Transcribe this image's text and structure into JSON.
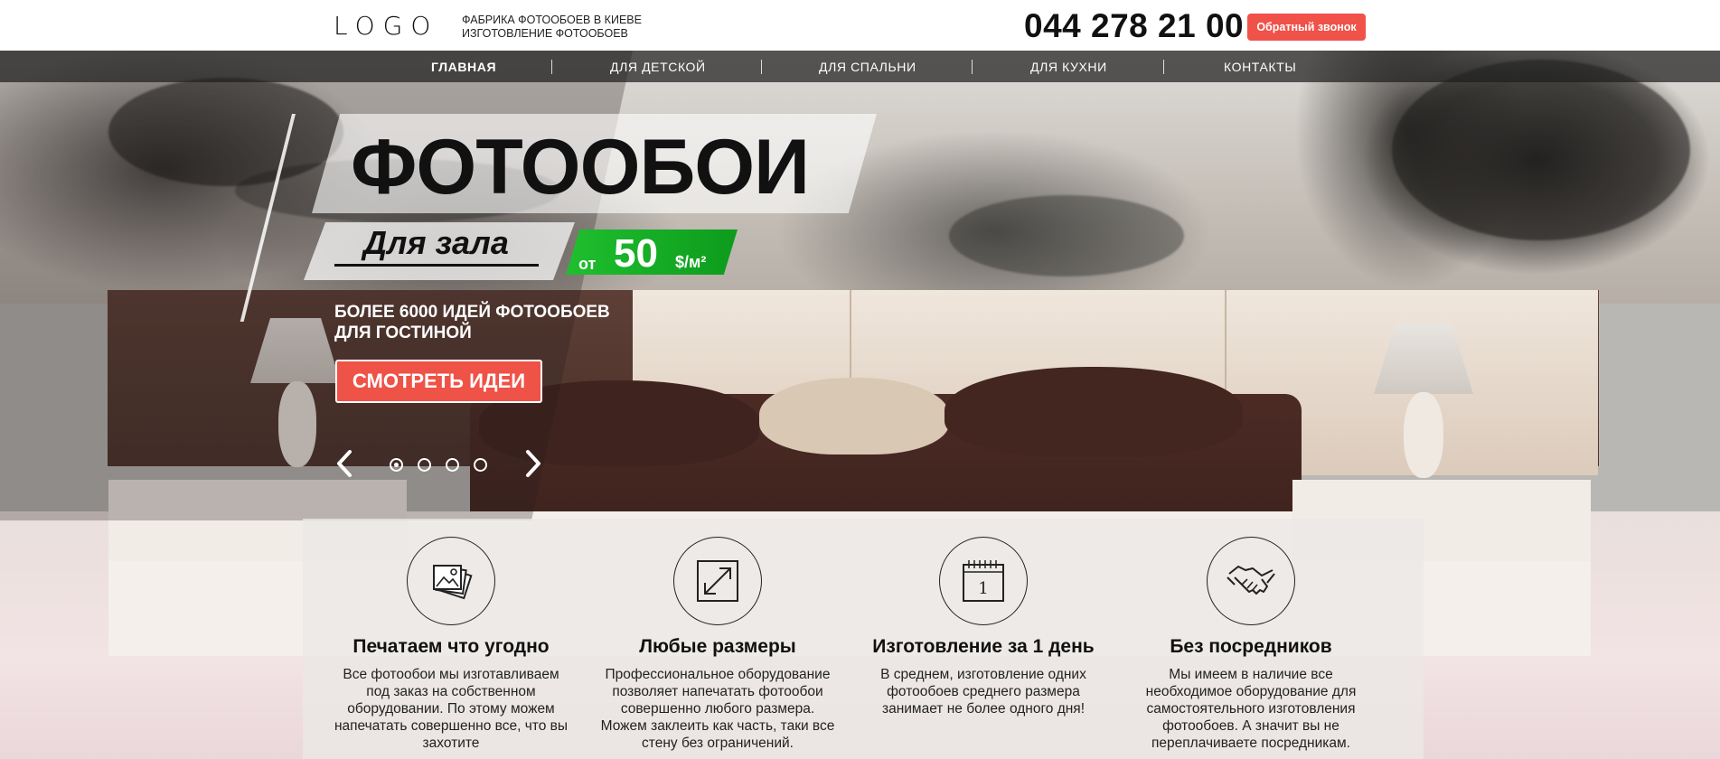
{
  "header": {
    "logo": "LOGO",
    "tagline_line1": "ФАБРИКА ФОТООБОЕВ В КИЕВЕ",
    "tagline_line2": "ИЗГОТОВЛЕНИЕ ФОТООБОЕВ",
    "phone": "044 278 21 00",
    "callback_label": "Обратный звонок"
  },
  "nav": {
    "items": [
      {
        "label": "ГЛАВНАЯ",
        "active": true
      },
      {
        "label": "ДЛЯ ДЕТСКОЙ"
      },
      {
        "label": "ДЛЯ СПАЛЬНИ"
      },
      {
        "label": "ДЛЯ КУХНИ"
      },
      {
        "label": "КОНТАКТЫ"
      }
    ]
  },
  "hero": {
    "title": "ФОТООБОИ",
    "subtitle": "Для зала",
    "price_from": "от",
    "price_value": "50",
    "price_unit": "$/м²",
    "lead_line1": "БОЛЕЕ 6000 ИДЕЙ ФОТООБОЕВ",
    "lead_line2": "ДЛЯ ГОСТИНОЙ",
    "cta_label": "СМОТРЕТЬ ИДЕИ",
    "slider_active_index": 0
  },
  "features": [
    {
      "icon": "photos-icon",
      "title": "Печатаем что угодно",
      "text": "Все фотообои мы изготавливаем под заказ на собственном оборудовании. По этому можем напечатать совершенно все, что вы захотите"
    },
    {
      "icon": "resize-icon",
      "title": "Любые размеры",
      "text": "Профессиональное оборудование позволяет напечатать фотообои совершенно любого размера. Можем заклеить как часть, таки все стену без ограничений."
    },
    {
      "icon": "calendar-icon",
      "icon_text": "1",
      "title": "Изготовление за 1 день",
      "text": "В среднем, изготовление одних фотообоев среднего размера занимает не более одного дня!"
    },
    {
      "icon": "handshake-icon",
      "title": "Без посредников",
      "text": "Мы имеем в наличие все необходимое оборудование для самостоятельного изготовления фотообоев. А значит вы не переплачиваете посредникам."
    }
  ],
  "colors": {
    "accent": "#f0524a",
    "price_green": "#15ab25",
    "nav_bg": "#1e1e1e"
  }
}
